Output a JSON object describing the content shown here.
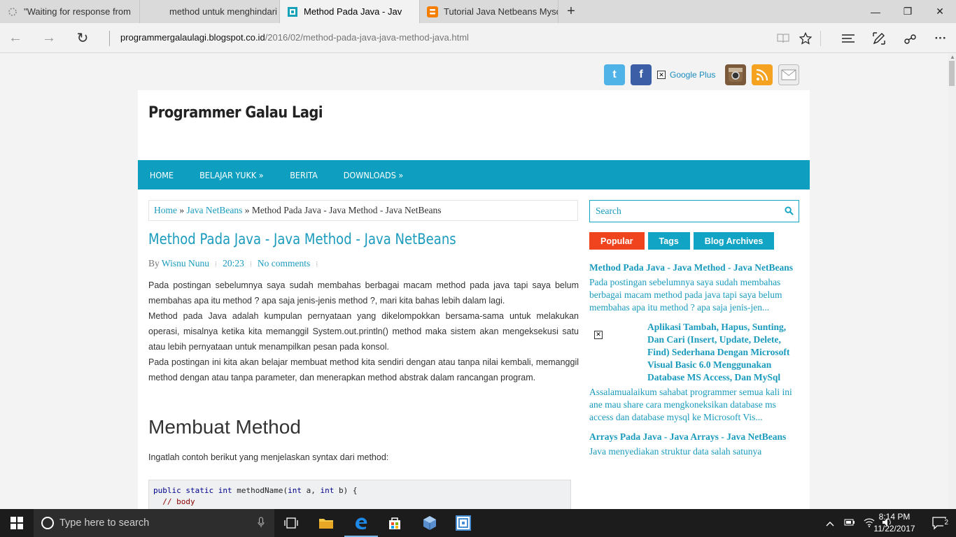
{
  "browser": {
    "tabs": [
      {
        "label": "\"Waiting for response from",
        "icon": "loading-spinner-icon"
      },
      {
        "label": "method untuk menghindari",
        "icon": "none"
      },
      {
        "label": "Method Pada Java - Jav",
        "icon": "page-favicon-icon"
      },
      {
        "label": "Tutorial Java Netbeans Mysq",
        "icon": "blogger-icon"
      }
    ],
    "new_tab": "+",
    "window_controls": {
      "minimize": "—",
      "restore": "❐",
      "close": "✕"
    },
    "url_host": "programmergalaulagi.blogspot.co.id",
    "url_path": "/2016/02/method-pada-java-java-method-java.html",
    "nav": {
      "back": "←",
      "forward": "→",
      "refresh": "↻"
    },
    "toolbar": {
      "reading_view": "📖",
      "favorite": "☆",
      "hub": "≡",
      "web_note": "✎",
      "share": "⌂",
      "more": "···"
    }
  },
  "social": {
    "twitter": "t",
    "facebook": "f",
    "google_plus_label": "Google Plus",
    "instagram": "◙",
    "rss": "◔",
    "mail": "✉"
  },
  "site": {
    "title": "Programmer Galau Lagi",
    "menu": [
      "HOME",
      "BELAJAR YUKK  »",
      "BERITA",
      "DOWNLOADS  »"
    ]
  },
  "breadcrumb": {
    "home": "Home",
    "sep1": " » ",
    "category": "Java NetBeans",
    "sep2": " » ",
    "current": "Method Pada Java - Java Method - Java NetBeans"
  },
  "post": {
    "title": "Method Pada Java - Java Method - Java NetBeans",
    "by": "By",
    "author": "Wisnu Nunu",
    "time": "20:23",
    "comments": "No comments",
    "paragraphs": [
      "Pada postingan sebelumnya saya sudah membahas berbagai macam method pada java tapi saya belum membahas apa itu method ? apa saja jenis-jenis method ?, mari kita bahas lebih dalam lagi.",
      "Method pada Java adalah kumpulan pernyataan yang dikelompokkan bersama-sama untuk melakukan operasi, misalnya ketika kita memanggil System.out.println() method maka sistem akan mengeksekusi satu atau lebih pernyataan untuk menampilkan pesan pada konsol.",
      "Pada postingan ini kita akan belajar membuat method kita sendiri dengan atau tanpa nilai kembali, memanggil method dengan atau tanpa parameter, dan menerapkan method abstrak dalam rancangan program."
    ],
    "section_heading": "Membuat Method",
    "intro": "Ingatlah contoh berikut yang menjelaskan syntax dari method:",
    "code": {
      "line1_kw1": "public static int",
      "line1_name": " methodName(",
      "line1_kw2": "int",
      "line1_a": " a, ",
      "line1_kw3": "int",
      "line1_b": " b) {",
      "line2": "  // body"
    }
  },
  "sidebar": {
    "search_placeholder": "Search",
    "tabs": [
      "Popular",
      "Tags",
      "Blog Archives"
    ],
    "items": [
      {
        "title": "Method Pada Java - Java Method - Java NetBeans",
        "desc": "Pada postingan sebelumnya saya sudah membahas berbagai macam method pada java tapi saya belum membahas apa itu method ? apa saja jenis-jen..."
      },
      {
        "title": "Aplikasi Tambah, Hapus, Sunting, Dan Cari (Insert, Update, Delete, Find) Sederhana Dengan Microsoft Visual Basic 6.0 Menggunakan Database MS Access, Dan MySql",
        "desc": "Assalamualaikum sahabat programmer semua kali ini ane mau share cara mengkoneksikan database ms access dan database mysql ke Microsoft Vis..."
      },
      {
        "title": "Arrays Pada Java - Java Arrays - Java NetBeans",
        "desc": "Java menyediakan struktur data salah satunya"
      }
    ]
  },
  "taskbar": {
    "search_placeholder": "Type here to search",
    "time": "8:14 PM",
    "date": "11/22/2017",
    "notification_count": "2"
  },
  "colors": {
    "accent": "#0e9fc0",
    "popular_tab": "#f0441f",
    "link": "#1a9bbd"
  }
}
